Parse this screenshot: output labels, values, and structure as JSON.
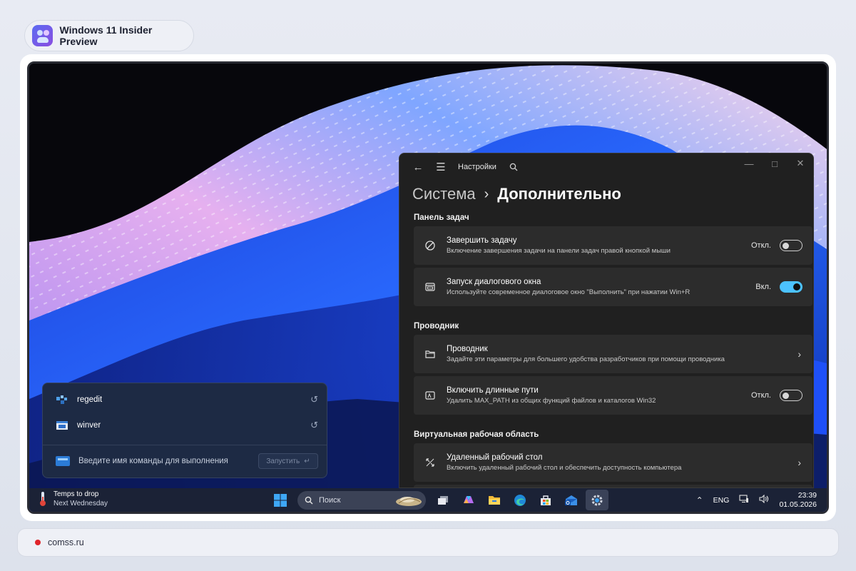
{
  "header": {
    "title": "Windows 11 Insider Preview"
  },
  "settings": {
    "window_title": "Настройки",
    "breadcrumb": {
      "parent": "Система",
      "current": "Дополнительно"
    },
    "sections": [
      {
        "title": "Панель задач",
        "items": [
          {
            "title": "Завершить задачу",
            "subtitle": "Включение завершения задачи на панели задач правой кнопкой мыши",
            "state": "Откл.",
            "toggle": "off"
          },
          {
            "title": "Запуск диалогового окна",
            "subtitle": "Используйте современное диалоговое окно \"Выполнить\" при нажатии Win+R",
            "state": "Вкл.",
            "toggle": "on"
          }
        ]
      },
      {
        "title": "Проводник",
        "items": [
          {
            "title": "Проводник",
            "subtitle": "Задайте эти параметры для большего удобства разработчиков при помощи проводника",
            "chevron": true
          },
          {
            "title": "Включить длинные пути",
            "subtitle": "Удалить MAX_PATH из общих функций файлов и каталогов Win32",
            "state": "Откл.",
            "toggle": "off"
          }
        ]
      },
      {
        "title": "Виртуальная рабочая область",
        "items": [
          {
            "title": "Удаленный рабочий стол",
            "subtitle": "Включить удаленный рабочий стол и обеспечить доступность компьютера",
            "chevron": true
          }
        ]
      }
    ]
  },
  "run_dialog": {
    "history": [
      {
        "label": "regedit",
        "icon": "regedit-icon"
      },
      {
        "label": "winver",
        "icon": "winver-icon"
      }
    ],
    "placeholder": "Введите имя команды для выполнения",
    "run_label": "Запустить"
  },
  "taskbar": {
    "weather": {
      "title": "Temps to drop",
      "subtitle": "Next Wednesday"
    },
    "search_label": "Поиск",
    "language": "ENG",
    "time": "23:39",
    "date": "01.05.2026"
  },
  "footer": {
    "label": "comss.ru"
  },
  "colors": {
    "accent": "#4cc2ff",
    "settings_bg": "#202020",
    "card_bg": "#2c2c2c",
    "taskbar_bg": "#1b2236",
    "run_bg": "#1d2a44"
  }
}
